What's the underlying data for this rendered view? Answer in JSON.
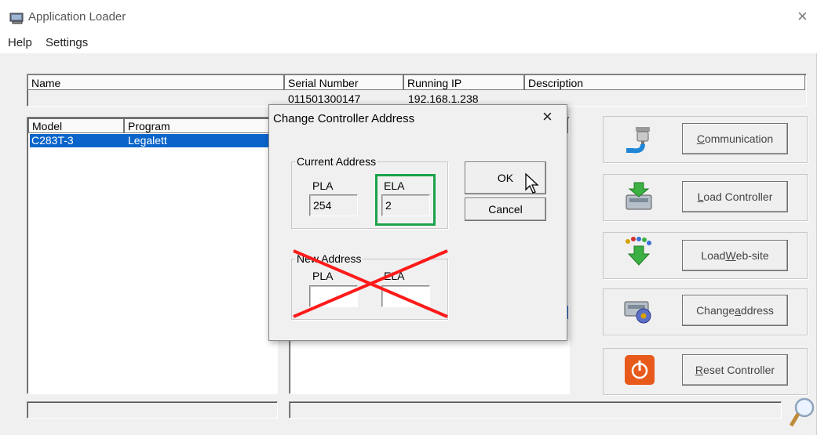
{
  "window": {
    "title": "Application Loader",
    "close_glyph": "×"
  },
  "menu": {
    "items": [
      "Help",
      "Settings"
    ]
  },
  "top_table": {
    "columns": [
      "Name",
      "Serial Number",
      "Running IP",
      "Description"
    ],
    "row": {
      "serial": "011501300147",
      "ip": "192.168.1.238"
    }
  },
  "model_table": {
    "columns": [
      "Model",
      "Program"
    ],
    "rows": [
      {
        "model": "C283T-3",
        "program": "Legalett"
      }
    ]
  },
  "side_buttons": [
    {
      "label_pre": "",
      "label_u": "C",
      "label_post": "ommunication",
      "icon": "plug-icon"
    },
    {
      "label_pre": "",
      "label_u": "L",
      "label_post": "oad Controller",
      "icon": "load-controller-icon"
    },
    {
      "label_pre": "Load ",
      "label_u": "W",
      "label_post": "eb-site",
      "icon": "load-website-icon"
    },
    {
      "label_pre": "Change ",
      "label_u": "a",
      "label_post": "ddress",
      "icon": "change-address-icon"
    },
    {
      "label_pre": "",
      "label_u": "R",
      "label_post": "eset Controller",
      "icon": "reset-icon"
    }
  ],
  "dialog": {
    "title": "Change Controller Address",
    "current_group": "Current Address",
    "new_group": "New Address",
    "pla_label": "PLA",
    "ela_label": "ELA",
    "current_pla": "254",
    "current_ela": "2",
    "new_pla": "",
    "new_ela": "",
    "ok_label": "OK",
    "cancel_label": "Cancel"
  },
  "colors": {
    "selection": "#0a64c9",
    "highlight_box": "#1aa34a",
    "cross_out": "#ff1a1a"
  }
}
